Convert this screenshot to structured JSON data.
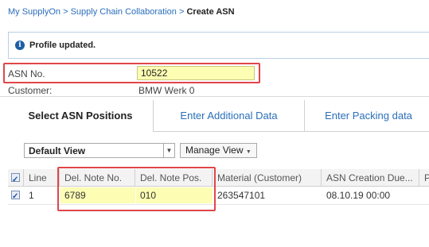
{
  "breadcrumb": {
    "items": [
      "My SupplyOn",
      "Supply Chain Collaboration"
    ],
    "separator": ">",
    "current": "Create ASN"
  },
  "notice": {
    "icon": "info-icon",
    "text": "Profile updated."
  },
  "asn": {
    "label": "ASN No.",
    "value": "10522"
  },
  "customer": {
    "label": "Customer:",
    "value": "BMW Werk 0"
  },
  "tabs": [
    {
      "label": "Select ASN Positions",
      "active": true
    },
    {
      "label": "Enter Additional Data",
      "active": false
    },
    {
      "label": "Enter Packing data",
      "active": false
    }
  ],
  "toolbar": {
    "view_label": "Default View",
    "manage_label": "Manage View"
  },
  "grid": {
    "columns": [
      "Line",
      "Del. Note No.",
      "Del. Note Pos.",
      "Material (Customer)",
      "ASN Creation Due...",
      "P"
    ],
    "rows": [
      {
        "checked": true,
        "line": "1",
        "del_note_no": "6789",
        "del_note_pos": "010",
        "material": "263547101",
        "asn_due": "08.10.19 00:00"
      }
    ]
  },
  "colors": {
    "link": "#2a6ebb",
    "highlight_border": "#e0464a",
    "input_yellow": "#fdfdb3"
  }
}
